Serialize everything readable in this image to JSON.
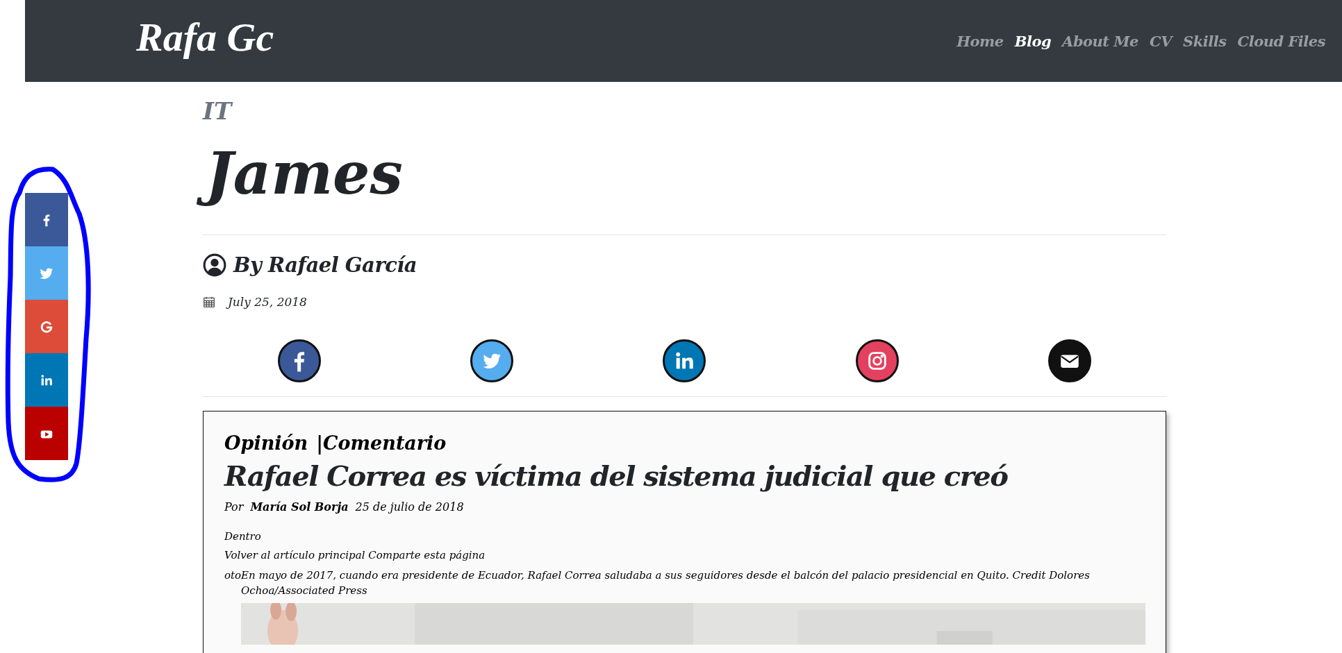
{
  "header": {
    "logo": "Rafa Gc",
    "nav": [
      {
        "label": "Home",
        "selected": false
      },
      {
        "label": "Blog",
        "selected": true
      },
      {
        "label": "About Me",
        "selected": false
      },
      {
        "label": "CV",
        "selected": false
      },
      {
        "label": "Skills",
        "selected": false
      },
      {
        "label": "Cloud Files",
        "selected": false
      }
    ]
  },
  "share_bar": [
    {
      "kind": "facebook"
    },
    {
      "kind": "twitter"
    },
    {
      "kind": "google"
    },
    {
      "kind": "linkedin"
    },
    {
      "kind": "youtube"
    }
  ],
  "annotation": {
    "kind": "circle"
  },
  "post": {
    "category": "IT",
    "title": "James",
    "author": "By Rafael García",
    "date": "July 25, 2018",
    "share_links": [
      {
        "kind": "facebook"
      },
      {
        "kind": "twitter"
      },
      {
        "kind": "linkedin"
      },
      {
        "kind": "instagram"
      },
      {
        "kind": "email"
      }
    ],
    "article": {
      "section": "Opinión",
      "subsection": "|Comentario",
      "headline": "Rafael Correa es víctima del sistema judicial que creó",
      "byline_prefix": "Por",
      "author": "María Sol Borja",
      "date": "25 de julio de 2018",
      "lines": [
        "Dentro",
        "Volver al artículo principal Comparte esta página"
      ],
      "caption": "otoEn mayo de 2017, cuando era presidente de Ecuador, Rafael Correa saludaba a sus seguidores desde el balcón del palacio presidencial en Quito.  Credit Dolores Ochoa/Associated Press"
    }
  }
}
